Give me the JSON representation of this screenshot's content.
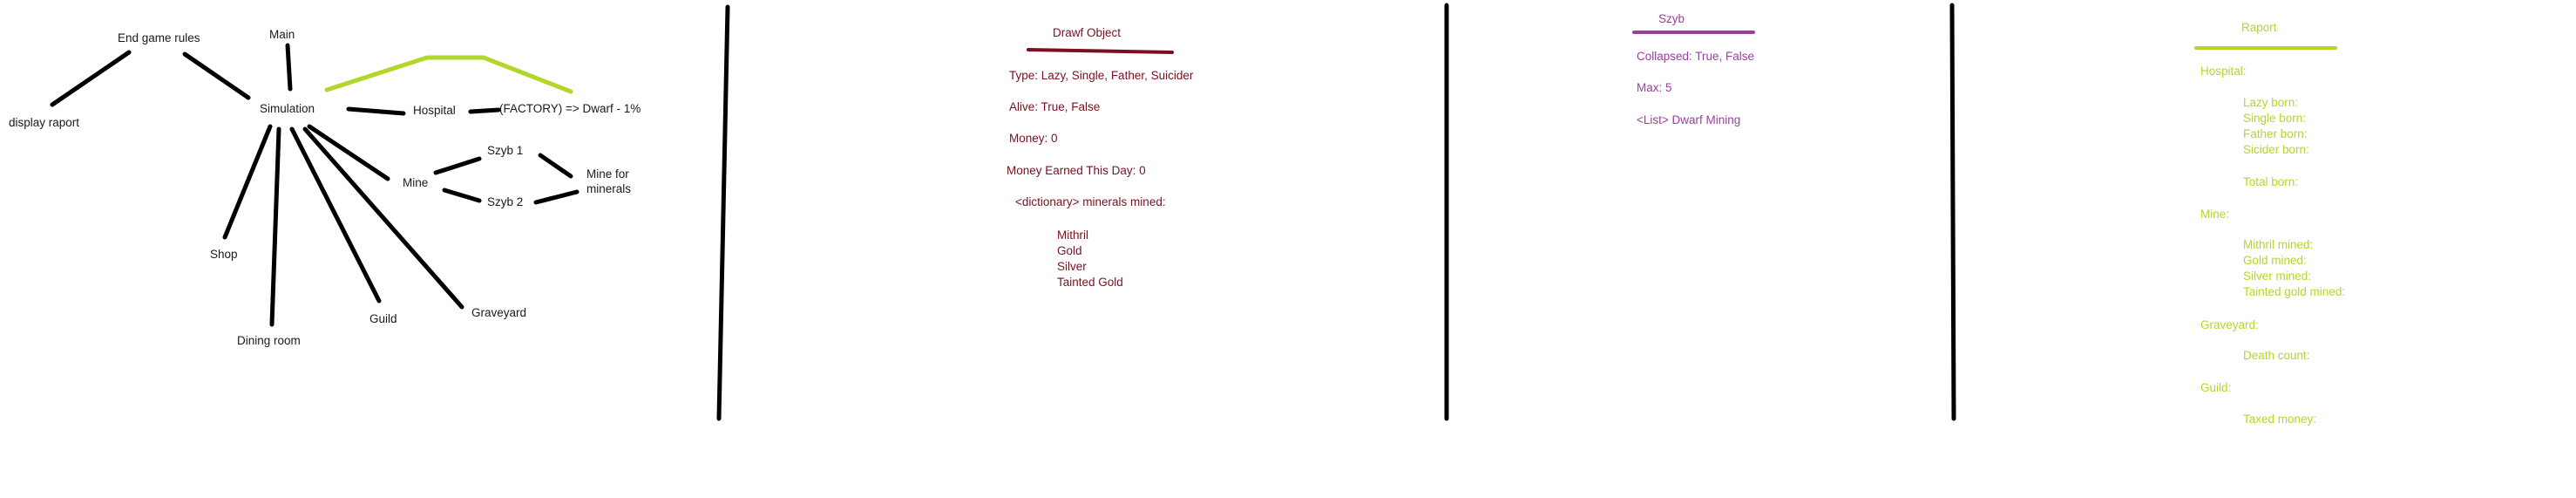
{
  "colors": {
    "ink": "#000000",
    "dwarf": "#7a1020",
    "szyb": "#9b3e9e",
    "raport": "#b3d62a"
  },
  "diagram": {
    "end_game_rules": "End game rules",
    "main": "Main",
    "display_raport": "display raport",
    "simulation": "Simulation",
    "hospital": "Hospital",
    "factory": "(FACTORY) => Dwarf - 1%",
    "szyb1": "Szyb 1",
    "szyb2": "Szyb 2",
    "mine": "Mine",
    "mine_for": "Mine for",
    "minerals": "minerals",
    "shop": "Shop",
    "dining_room": "Dining room",
    "guild": "Guild",
    "graveyard": "Graveyard"
  },
  "dwarf": {
    "title": "Drawf Object",
    "type": "Type: Lazy, Single, Father, Suicider",
    "alive": "Alive: True, False",
    "money": "Money: 0",
    "money_earned": "Money Earned This Day: 0",
    "minerals_mined": "<dictionary> minerals mined:",
    "minerals": [
      "Mithril",
      "Gold",
      "Silver",
      "Tainted Gold"
    ]
  },
  "szyb": {
    "title": "Szyb",
    "collapsed": "Collapsed: True, False",
    "max": "Max: 5",
    "list": "<List> Dwarf Mining"
  },
  "raport": {
    "title": "Raport",
    "hospital": "Hospital:",
    "hospital_items": [
      "Lazy born:",
      "Single born:",
      "Father born:",
      "Sicider born:"
    ],
    "total_born": "Total born:",
    "mine": "Mine:",
    "mine_items": [
      "Mithril mined:",
      "Gold mined:",
      "Silver mined:",
      "Tainted gold mined:"
    ],
    "graveyard": "Graveyard:",
    "death_count": "Death count:",
    "guild": "Guild:",
    "taxed_money": "Taxed money:"
  }
}
